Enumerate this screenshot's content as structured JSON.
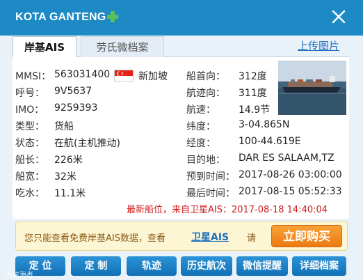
{
  "header": {
    "title": "KOTA GANTENG",
    "plus_icon": "green-plus-icon",
    "close_icon": "close-icon"
  },
  "tabs": [
    {
      "label": "岸基AIS",
      "active": true
    },
    {
      "label": "劳氏微档案",
      "active": false
    }
  ],
  "upload_link": "上传图片",
  "left_fields": [
    {
      "label": "MMSI：",
      "value": "563031400"
    },
    {
      "label": "呼号：",
      "value": "9V5637"
    },
    {
      "label": "IMO：",
      "value": "9259393"
    },
    {
      "label": "类型：",
      "value": "货船"
    },
    {
      "label": "状态：",
      "value": "在航(主机推动)"
    },
    {
      "label": "船长：",
      "value": "226米"
    },
    {
      "label": "船宽：",
      "value": "32米"
    },
    {
      "label": "吃水：",
      "value": "11.1米"
    }
  ],
  "flag": {
    "country": "新加坡",
    "colors": [
      "#e2231a",
      "#ffffff"
    ]
  },
  "right_fields": [
    {
      "label": "船首向：",
      "value": "312度"
    },
    {
      "label": "航迹向：",
      "value": "311度"
    },
    {
      "label": "航速：",
      "value": "14.9节"
    },
    {
      "label": "纬度：",
      "value": "3-04.865N"
    },
    {
      "label": "经度：",
      "value": "100-44.619E"
    },
    {
      "label": "目的地：",
      "value": "DAR ES SALAAM,TZ"
    },
    {
      "label": "预到时间：",
      "value": "2017-08-26 03:00:00"
    },
    {
      "label": "最后时间：",
      "value": "2017-08-15 05:52:33"
    }
  ],
  "latest_position": "最新船位，来自卫星AIS：2017-08-18 14:40:04",
  "notice": {
    "text": "您只能查看免费岸基AIS数据，查看",
    "link": "卫星AIS",
    "tail": "请",
    "buy_button": "立即购买"
  },
  "actions": [
    "定 位",
    "定 制",
    "轨迹",
    "历史航次",
    "微信提醒",
    "详细档案"
  ],
  "watermark": "大航海者",
  "colors": {
    "header": "#1d8ac6",
    "panel": "#eaf2f9",
    "accent_red": "#d11a1a",
    "buy": "#ec7a10",
    "link": "#1e6fbd"
  }
}
